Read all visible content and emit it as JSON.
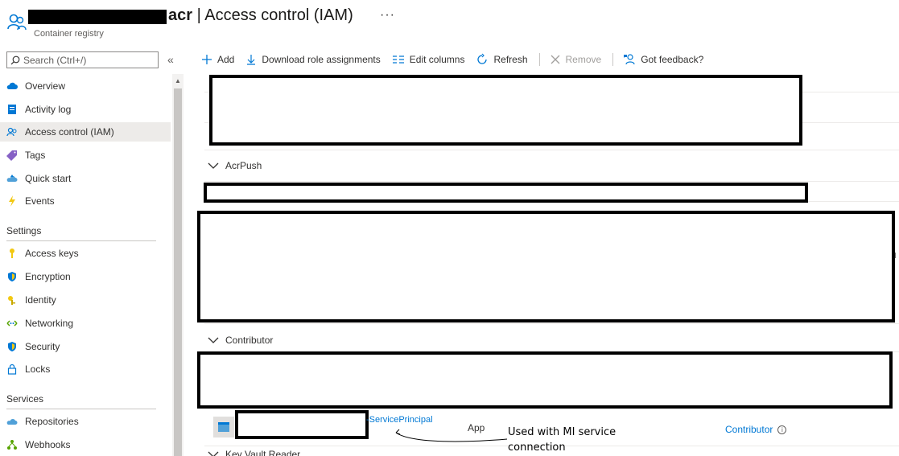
{
  "header": {
    "title_suffix": "acr",
    "title_separator": " | ",
    "title_page": "Access control (IAM)",
    "more": "···",
    "subtitle": "Container registry"
  },
  "search": {
    "placeholder": "Search (Ctrl+/)",
    "value": ""
  },
  "collapse_label": "«",
  "sidebar": {
    "items": [
      {
        "label": "Overview",
        "icon": "cloud-overview-icon",
        "active": false
      },
      {
        "label": "Activity log",
        "icon": "activity-log-icon",
        "active": false
      },
      {
        "label": "Access control (IAM)",
        "icon": "people-icon",
        "active": true
      },
      {
        "label": "Tags",
        "icon": "tag-icon",
        "active": false
      },
      {
        "label": "Quick start",
        "icon": "quick-start-icon",
        "active": false
      },
      {
        "label": "Events",
        "icon": "lightning-icon",
        "active": false
      }
    ],
    "settings_header": "Settings",
    "settings_items": [
      {
        "label": "Access keys",
        "icon": "key-icon"
      },
      {
        "label": "Encryption",
        "icon": "shield-icon"
      },
      {
        "label": "Identity",
        "icon": "identity-key-icon"
      },
      {
        "label": "Networking",
        "icon": "networking-icon"
      },
      {
        "label": "Security",
        "icon": "security-shield-icon"
      },
      {
        "label": "Locks",
        "icon": "lock-icon"
      }
    ],
    "services_header": "Services",
    "services_items": [
      {
        "label": "Repositories",
        "icon": "cloud-repo-icon"
      },
      {
        "label": "Webhooks",
        "icon": "webhook-icon"
      }
    ]
  },
  "toolbar": {
    "add": "Add",
    "download": "Download role assignments",
    "edit_columns": "Edit columns",
    "refresh": "Refresh",
    "remove": "Remove",
    "feedback": "Got feedback?"
  },
  "groups": {
    "acrpush": "AcrPush",
    "contributor": "Contributor",
    "next": "Key Vault Reader"
  },
  "row": {
    "type_suffix": "-ServicePrincipal",
    "type": "App",
    "role": "Contributor",
    "info": "i"
  },
  "annotation": "Used with MI service connection",
  "colors": {
    "accent": "#0078d4",
    "active_bg": "#edebe9",
    "text": "#323130"
  }
}
